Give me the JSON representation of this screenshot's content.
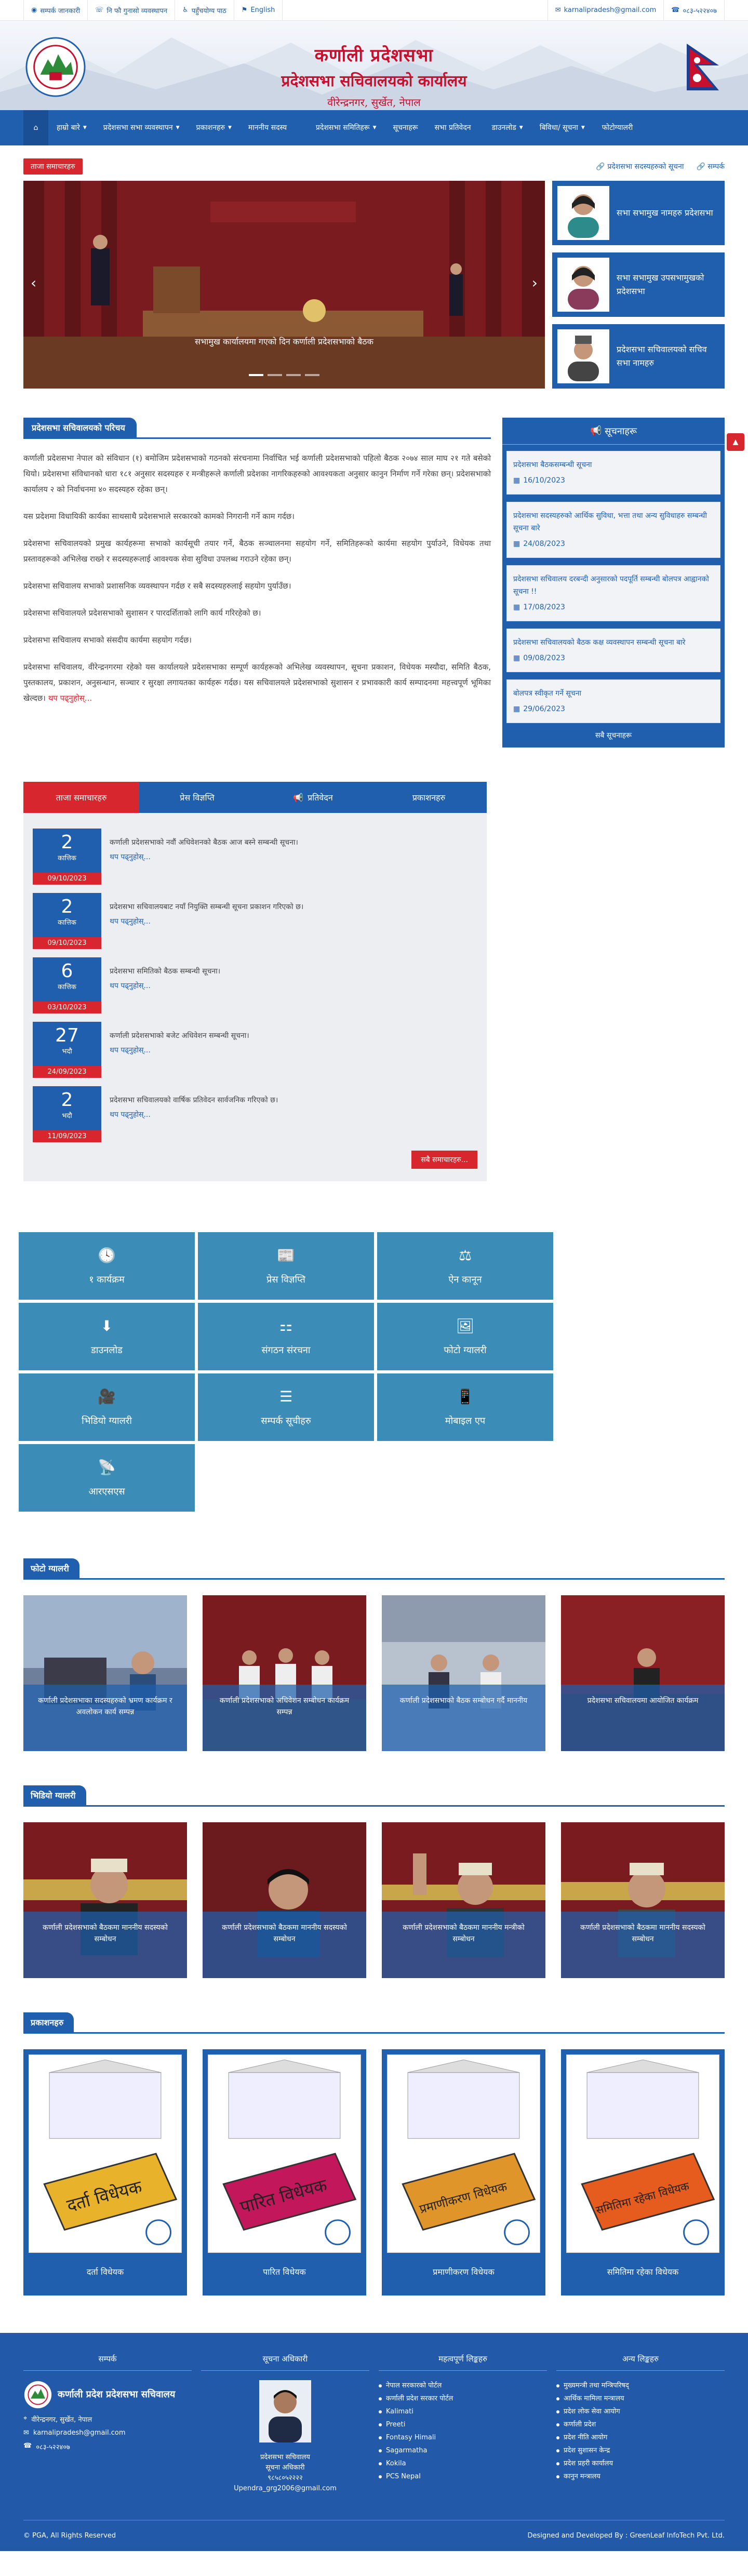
{
  "topbar": {
    "left": [
      "सम्पर्क जानकारी",
      "नि फौ गुनासो व्यवस्थापन",
      "पहुँचयोग्य पाठ",
      "English"
    ],
    "email": "karnalipradesh@gmail.com",
    "phone": "०८३-५२२४०७"
  },
  "header": {
    "title1": "कर्णाली प्रदेशसभा",
    "title2": "प्रदेशसभा सचिवालयको कार्यालय",
    "title3": "वीरेन्द्रनगर, सुर्खेत, नेपाल"
  },
  "nav": {
    "items": [
      {
        "label": "हाम्रो बारे",
        "caret": true
      },
      {
        "label": "प्रदेशसभा सभा व्यवस्थापन",
        "caret": true
      },
      {
        "label": "प्रकाशनहरु",
        "caret": true
      },
      {
        "label": "माननीय सदस्य",
        "caret": false
      },
      {
        "label": "प्रदेशसभा समितिहरू",
        "caret": true
      },
      {
        "label": "सूचनाहरू",
        "caret": false
      },
      {
        "label": "सभा प्रतिवेदन",
        "caret": false
      },
      {
        "label": "डाउनलोड",
        "caret": true
      },
      {
        "label": "बिविधा/ सूचना",
        "caret": true
      },
      {
        "label": "फोटोग्यालरी",
        "caret": false
      }
    ]
  },
  "newsbar": {
    "label": "ताजा समाचारहरु",
    "link1": "प्रदेशसभा सदस्यहरुको सूचना",
    "link2": "सम्पर्क"
  },
  "slider": {
    "caption": "सभामुख कार्यालयमा गएको दिन कर्णाली प्रदेशसभाको बैठक"
  },
  "officials": [
    {
      "name": "सभा सभामुख नामहरु प्रदेशसभा"
    },
    {
      "name": "सभा सभामुख उपसभामुखको प्रदेशसभा"
    },
    {
      "name": "प्रदेशसभा सचिवालयको सचिव सभा नामहरु"
    }
  ],
  "about": {
    "heading": "प्रदेशसभा सचिवालयको परिचय",
    "paragraphs": [
      "कर्णाली प्रदेशसभा नेपाल को संविधान (१) बमोजिम प्रदेशसभाको गठनको संरचनामा निर्वाचित भई कर्णाली प्रदेशसभाको पहिलो बैठक २०७४ साल माघ २१ गते बसेको थियो। प्रदेशसभा संविधानको धारा १८१ अनुसार सदस्यहरु र मन्त्रीहरूले कर्णाली प्रदेशका नागरिकहरुको आवश्यकता अनुसार कानुन निर्माण गर्ने गरेका छन्। प्रदेशसभाको कार्यालय २ को निर्वाचनमा ४० सदस्यहरु रहेका छन्।",
      "यस प्रदेशमा विधायिकी कार्यका साथसाथै प्रदेशसभाले सरकारको कामको निगरानी गर्ने काम गर्दछ।",
      "प्रदेशसभा सचिवालयको प्रमुख कार्यहरूमा सभाको कार्यसूची तयार गर्ने, बैठक सञ्चालनमा सहयोग गर्ने, समितिहरूको कार्यमा सहयोग पुर्याउने, विधेयक तथा प्रस्तावहरूको अभिलेख राख्ने र सदस्यहरूलाई आवश्यक सेवा सुविधा उपलब्ध गराउने रहेका छन्।",
      "प्रदेशसभा सचिवालय सभाको प्रशासनिक व्यवस्थापन गर्दछ र सबै सदस्यहरुलाई सहयोग पुर्याउँछ।",
      "प्रदेशसभा सचिवालयले प्रदेशसभाको सुशासन र पारदर्शिताको लागि कार्य गरिरहेको छ।",
      "प्रदेशसभा सचिवालय सभाको संसदीय कार्यमा सहयोग गर्दछ।",
      "प्रदेशसभा सचिवालय, वीरेन्द्रनगरमा रहेको यस कार्यालयले प्रदेशसभाका सम्पूर्ण कार्यहरूको अभिलेख व्यवस्थापन, सूचना प्रकाशन, विधेयक मस्यौदा, समिति बैठक, पुस्तकालय, प्रकाशन, अनुसन्धान, सञ्चार र सुरक्षा लगायतका कार्यहरू गर्दछ। यस सचिवालयले प्रदेशसभाको सुशासन र प्रभावकारी कार्य सम्पादनमा महत्त्वपूर्ण भूमिका खेल्दछ।"
    ],
    "more": "थप पढ्नुहोस्..."
  },
  "notices": {
    "heading": "सूचनाहरू",
    "items": [
      {
        "title": "प्रदेशसभा बैठकसम्बन्धी सूचना",
        "date": "16/10/2023"
      },
      {
        "title": "प्रदेशसभा सदस्यहरुको आर्थिक सुविधा, भत्ता तथा अन्य सुविधाहरु सम्बन्धी सूचना बारे",
        "date": "24/08/2023"
      },
      {
        "title": "प्रदेशसभा सचिवालय दरबन्दी अनुसारको पदपूर्ति सम्बन्धी बोलपत्र आह्वानको सूचना !!",
        "date": "17/08/2023"
      },
      {
        "title": "प्रदेशसभा सचिवालयको बैठक कक्ष व्यवस्थापन सम्बन्धी सूचना बारे",
        "date": "09/08/2023"
      },
      {
        "title": "बोलपत्र स्वीकृत गर्ने सूचना",
        "date": "29/06/2023"
      }
    ],
    "all": "सबै सूचनाहरू"
  },
  "tabs": {
    "items": [
      "ताजा समाचारहरु",
      "प्रेस विज्ञप्ति",
      "प्रतिवेदन",
      "प्रकाशनहरु"
    ],
    "news": [
      {
        "day": "2",
        "month": "कात्तिक",
        "full": "09/10/2023",
        "text": "कर्णाली प्रदेशसभाको नवौं अधिवेशनको बैठक आज बस्ने सम्बन्धी सूचना।",
        "rm": "थप पढ्नुहोस्..."
      },
      {
        "day": "2",
        "month": "कात्तिक",
        "full": "09/10/2023",
        "text": "प्रदेशसभा सचिवालयबाट नयाँ नियुक्ति सम्बन्धी सूचना प्रकाशन गरिएको छ।",
        "rm": "थप पढ्नुहोस्..."
      },
      {
        "day": "6",
        "month": "कात्तिक",
        "full": "03/10/2023",
        "text": "प्रदेशसभा समितिको बैठक सम्बन्धी सूचना।",
        "rm": "थप पढ्नुहोस्..."
      },
      {
        "day": "27",
        "month": "भदौ",
        "full": "24/09/2023",
        "text": "कर्णाली प्रदेशसभाको बजेट अधिवेशन सम्बन्धी सूचना।",
        "rm": "थप पढ्नुहोस्..."
      },
      {
        "day": "2",
        "month": "भदौ",
        "full": "11/09/2023",
        "text": "प्रदेशसभा सचिवालयको वार्षिक प्रतिवेदन सार्वजनिक गरिएको छ।",
        "rm": "थप पढ्नुहोस्..."
      }
    ],
    "all": "सबै समाचारहरु..."
  },
  "quick": [
    {
      "icon": "clock-icon",
      "glyph": "🕓",
      "label": "१ कार्यक्रम"
    },
    {
      "icon": "newspaper-icon",
      "glyph": "📰",
      "label": "प्रेस विज्ञप्ति"
    },
    {
      "icon": "scale-icon",
      "glyph": "⚖",
      "label": "ऐन कानून"
    },
    {
      "icon": "download-icon",
      "glyph": "⬇",
      "label": "डाउनलोड"
    },
    {
      "icon": "sitemap-icon",
      "glyph": "⚏",
      "label": "संगठन संरचना"
    },
    {
      "icon": "image-icon",
      "glyph": "🖼",
      "label": "फोटो ग्यालरी"
    },
    {
      "icon": "video-icon",
      "glyph": "🎥",
      "label": "भिडियो ग्यालरी"
    },
    {
      "icon": "list-icon",
      "glyph": "☰",
      "label": "सम्पर्क सूचीहरु"
    },
    {
      "icon": "mobile-icon",
      "glyph": "📱",
      "label": "मोबाइल एप"
    },
    {
      "icon": "rss-icon",
      "glyph": "📡",
      "label": "आरएसएस"
    }
  ],
  "photo_gallery": {
    "heading": "फोटो ग्यालरी",
    "items": [
      "कर्णाली प्रदेशसभाका सदस्यहरुको भ्रमण कार्यक्रम र अवलोकन कार्य सम्पन्न",
      "कर्णाली प्रदेशसभाको अधिवेशन सम्बोधन कार्यक्रम सम्पन्न",
      "कर्णाली प्रदेशसभाको बैठक सम्बोधन गर्दै माननीय",
      "प्रदेशसभा सचिवालयमा आयोजित कार्यक्रम"
    ]
  },
  "video_gallery": {
    "heading": "भिडियो ग्यालरी",
    "items": [
      "कर्णाली प्रदेशसभाको बैठकमा माननीय सदस्यको सम्बोधन",
      "कर्णाली प्रदेशसभाको बैठकमा माननीय सदस्यको सम्बोधन",
      "कर्णाली प्रदेशसभाको बैठकमा माननीय मन्त्रीको सम्बोधन",
      "कर्णाली प्रदेशसभाको बैठकमा माननीय सदस्यको सम्बोधन"
    ]
  },
  "publications": {
    "heading": "प्रकाशनहरु",
    "items": [
      {
        "name": "दर्ता विधेयक",
        "cover_text": "दर्ता विधेयक",
        "color": "#e8b22a"
      },
      {
        "name": "पारित विधेयक",
        "cover_text": "पारित विधेयक",
        "color": "#c2185b"
      },
      {
        "name": "प्रमाणीकरण विधेयक",
        "cover_text": "प्रमाणीकरण विधेयक",
        "color": "#e0952a"
      },
      {
        "name": "समितिमा रहेका विधेयक",
        "cover_text": "समितिमा रहेका विधेयक",
        "color": "#e65b1e"
      }
    ]
  },
  "footer": {
    "col1": {
      "heading": "सम्पर्क",
      "brand": "कर्णाली प्रदेश प्रदेशसभा सचिवालय",
      "address": "वीरेन्द्रनगर, सुर्खेत, नेपाल",
      "email": "karnalipradesh@gmail.com",
      "phone": "०८३-५२२४०७"
    },
    "col2": {
      "heading": "सूचना अधिकारी",
      "name": "प्रदेशसभा सचिवालय",
      "role": "सूचना अधिकारी",
      "phone": "९८५८०५२२२२",
      "email": "Upendra_grg2006@gmail.com"
    },
    "col3": {
      "heading": "महत्वपूर्ण लिङ्कहरु",
      "links": [
        "नेपाल सरकारको पोर्टल",
        "कर्णाली प्रदेश सरकार पोर्टल",
        "Kalimati",
        "Preeti",
        "Fontasy Himali",
        "Sagarmatha",
        "Kokila",
        "PCS Nepal"
      ]
    },
    "col4": {
      "heading": "अन्य लिङ्कहरु",
      "links": [
        "मुख्यमन्त्री तथा मन्त्रिपरिषद्",
        "आर्थिक मामिला मन्त्रालय",
        "प्रदेश लोक सेवा आयोग",
        "कर्णाली प्रदेश",
        "प्रदेश नीति आयोग",
        "प्रदेश सुशासन केन्द्र",
        "प्रदेश प्रहरी कार्यालय",
        "कानुन मन्त्रालय"
      ]
    },
    "copyright": "© PGA, All Rights Reserved",
    "developer": "Designed and Developed By : GreenLeaf InfoTech Pvt. Ltd."
  }
}
